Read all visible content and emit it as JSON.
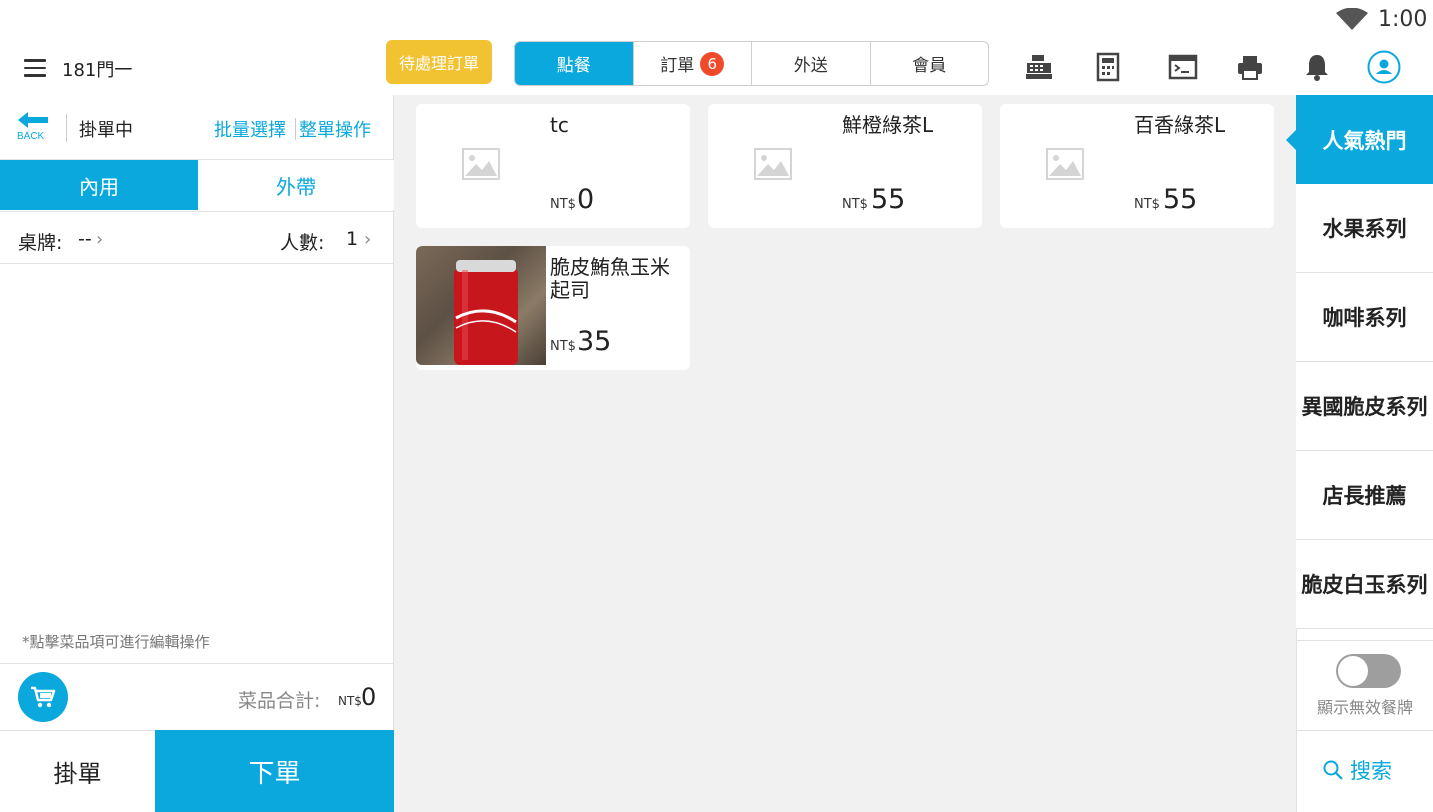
{
  "status": {
    "clock": "1:00",
    "wifi_icon": "wifi-icon"
  },
  "topbar": {
    "store_name": "181門一",
    "pending_button": "待處理訂單",
    "tabs": [
      {
        "label": "點餐",
        "active": true
      },
      {
        "label": "訂單",
        "badge": "6"
      },
      {
        "label": "外送"
      },
      {
        "label": "會員"
      }
    ],
    "icons": [
      "cash-register-icon",
      "calculator-icon",
      "terminal-icon",
      "printer-icon",
      "bell-icon",
      "user-icon"
    ]
  },
  "left": {
    "back_label": "BACK",
    "status": "掛單中",
    "batch_select": "批量選擇",
    "whole_op": "整單操作",
    "dine_in": "內用",
    "take_out": "外帶",
    "table_label": "桌牌:",
    "table_value": "--",
    "people_label": "人數:",
    "people_value": "1",
    "hint": "*點擊菜品項可進行編輯操作",
    "total_label": "菜品合計:",
    "total_currency": "NT$",
    "total_value": "0",
    "hold_button": "掛單",
    "submit_button": "下單"
  },
  "products": [
    {
      "name": "tc",
      "currency": "NT$",
      "price": "0",
      "has_photo": false
    },
    {
      "name": "鮮橙綠茶L",
      "currency": "NT$",
      "price": "55",
      "has_photo": false
    },
    {
      "name": "百香綠茶L",
      "currency": "NT$",
      "price": "55",
      "has_photo": false
    },
    {
      "name": "脆皮鮪魚玉米起司",
      "currency": "NT$",
      "price": "35",
      "has_photo": true
    }
  ],
  "categories": [
    {
      "label": "人氣熱門",
      "active": true
    },
    {
      "label": "水果系列"
    },
    {
      "label": "咖啡系列"
    },
    {
      "label": "異國脆皮系列"
    },
    {
      "label": "店長推薦"
    },
    {
      "label": "脆皮白玉系列"
    }
  ],
  "right": {
    "toggle_label": "顯示無效餐牌",
    "toggle_on": false,
    "search_label": "搜索"
  },
  "colors": {
    "accent": "#0aa8dd",
    "pending": "#f1c232",
    "badge": "#f04a2a"
  }
}
